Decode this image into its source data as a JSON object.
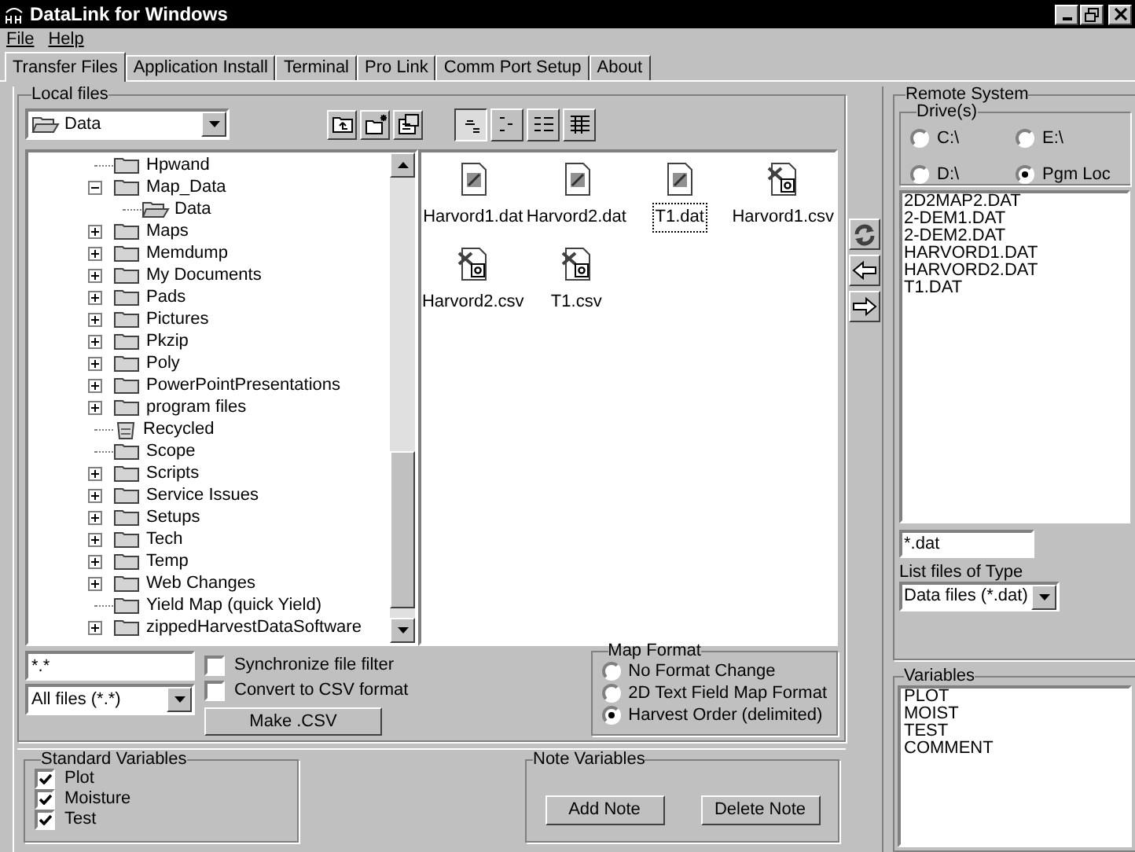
{
  "window": {
    "title": "DataLink for Windows"
  },
  "menu": [
    "File",
    "Help"
  ],
  "tabs": [
    {
      "label": "Transfer Files",
      "selected": true
    },
    {
      "label": "Application Install",
      "selected": false
    },
    {
      "label": "Terminal",
      "selected": false
    },
    {
      "label": "Pro Link",
      "selected": false
    },
    {
      "label": "Comm Port Setup",
      "selected": false
    },
    {
      "label": "About",
      "selected": false
    }
  ],
  "local_files": {
    "title": "Local files",
    "folder_combo": "Data",
    "view_buttons": [
      {
        "kind": "large",
        "pressed": true
      },
      {
        "kind": "small",
        "pressed": false
      },
      {
        "kind": "list",
        "pressed": false
      },
      {
        "kind": "details",
        "pressed": false
      }
    ],
    "tree": [
      {
        "label": "Hpwand",
        "kind": "folder"
      },
      {
        "label": "Map_Data",
        "kind": "folder",
        "expanded": true,
        "children": [
          {
            "label": "Data",
            "kind": "open-folder"
          }
        ]
      },
      {
        "label": "Maps",
        "kind": "folder",
        "expanded": false
      },
      {
        "label": "Memdump",
        "kind": "folder",
        "expanded": false
      },
      {
        "label": "My Documents",
        "kind": "folder",
        "expanded": false
      },
      {
        "label": "Pads",
        "kind": "folder",
        "expanded": false
      },
      {
        "label": "Pictures",
        "kind": "folder",
        "expanded": false
      },
      {
        "label": "Pkzip",
        "kind": "folder",
        "expanded": false
      },
      {
        "label": "Poly",
        "kind": "folder",
        "expanded": false
      },
      {
        "label": "PowerPointPresentations",
        "kind": "folder",
        "expanded": false
      },
      {
        "label": "program files",
        "kind": "folder",
        "expanded": false
      },
      {
        "label": "Recycled",
        "kind": "recycle"
      },
      {
        "label": "Scope",
        "kind": "folder"
      },
      {
        "label": "Scripts",
        "kind": "folder",
        "expanded": false
      },
      {
        "label": "Service Issues",
        "kind": "folder",
        "expanded": false
      },
      {
        "label": "Setups",
        "kind": "folder",
        "expanded": false
      },
      {
        "label": "Tech",
        "kind": "folder",
        "expanded": false
      },
      {
        "label": "Temp",
        "kind": "folder",
        "expanded": false
      },
      {
        "label": "Web Changes",
        "kind": "folder",
        "expanded": false
      },
      {
        "label": "Yield Map (quick Yield)",
        "kind": "folder"
      },
      {
        "label": "zippedHarvestDataSoftware",
        "kind": "folder",
        "expanded": false
      }
    ],
    "files": [
      {
        "name": "Harvord1.dat",
        "kind": "dat",
        "focused": false
      },
      {
        "name": "Harvord2.dat",
        "kind": "dat",
        "focused": false
      },
      {
        "name": "T1.dat",
        "kind": "dat",
        "focused": true
      },
      {
        "name": "Harvord1.csv",
        "kind": "csv",
        "focused": false
      },
      {
        "name": "Harvord2.csv",
        "kind": "csv",
        "focused": false
      },
      {
        "name": "T1.csv",
        "kind": "csv",
        "focused": false
      }
    ],
    "filter_field": "*.*",
    "filter_combo": "All files (*.*)",
    "options": [
      {
        "label": "Synchronize file filter",
        "checked": false
      },
      {
        "label": "Convert to CSV format",
        "checked": false
      }
    ],
    "make_csv_button": "Make .CSV"
  },
  "map_format": {
    "title": "Map Format",
    "options": [
      {
        "label": "No Format Change",
        "selected": false
      },
      {
        "label": "2D Text Field Map Format",
        "selected": false
      },
      {
        "label": "Harvest Order (delimited)",
        "selected": true
      }
    ]
  },
  "standard_variables": {
    "title": "Standard Variables",
    "items": [
      {
        "label": "Plot",
        "checked": true
      },
      {
        "label": "Moisture",
        "checked": true
      },
      {
        "label": "Test",
        "checked": true
      }
    ]
  },
  "note_variables": {
    "title": "Note Variables",
    "buttons": [
      "Add Note",
      "Delete Note"
    ]
  },
  "remote_system": {
    "title": "Remote System",
    "drives_title": "Drive(s)",
    "drives": [
      {
        "label": "C:\\",
        "selected": false
      },
      {
        "label": "E:\\",
        "selected": false
      },
      {
        "label": "D:\\",
        "selected": false
      },
      {
        "label": "Pgm Loc",
        "selected": true
      }
    ],
    "files": [
      "2D2MAP2.DAT",
      "2-DEM1.DAT",
      "2-DEM2.DAT",
      "HARVORD1.DAT",
      "HARVORD2.DAT",
      "T1.DAT"
    ],
    "filter_field": "*.dat",
    "type_label": "List files of Type",
    "type_combo": "Data files (*.dat)",
    "variables_title": "Variables",
    "variables": [
      "PLOT",
      "MOIST",
      "TEST",
      "COMMENT"
    ]
  }
}
